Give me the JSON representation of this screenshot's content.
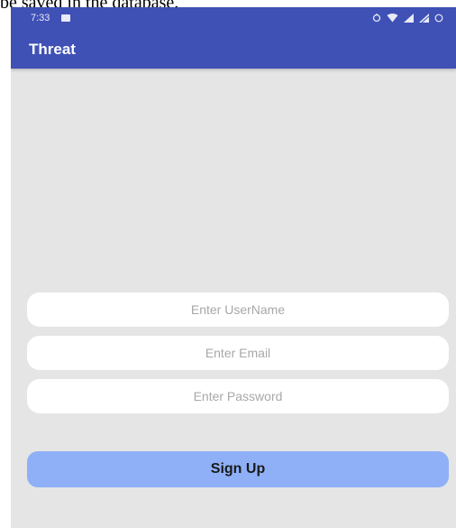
{
  "document": {
    "caption": "be saved in the database."
  },
  "status_bar": {
    "time": "7:33",
    "icons": [
      "notification-icon",
      "vibrate-icon",
      "wifi-icon",
      "signal-icon",
      "signal-roaming-icon",
      "battery-icon"
    ]
  },
  "app_bar": {
    "title": "Threat",
    "color": "#3f51b5"
  },
  "form": {
    "username_placeholder": "Enter UserName",
    "email_placeholder": "Enter Email",
    "password_placeholder": "Enter Password",
    "signup_label": "Sign Up",
    "button_color": "#8fb0f7",
    "background_color": "#e5e5e5"
  }
}
